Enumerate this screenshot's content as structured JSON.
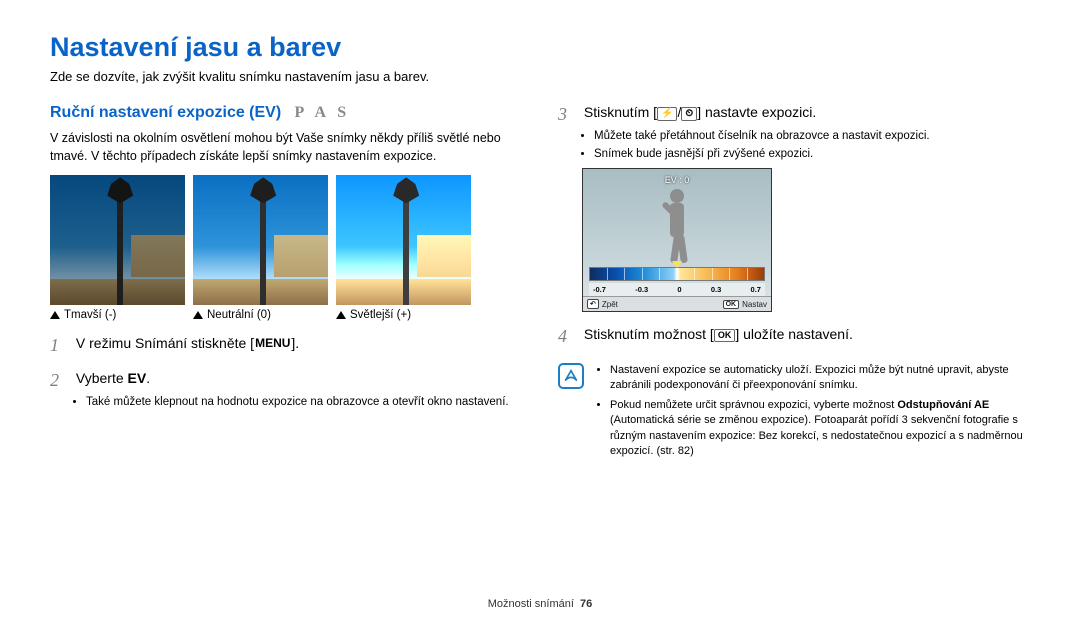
{
  "title": "Nastavení jasu a barev",
  "intro": "Zde se dozvíte, jak zvýšit kvalitu snímku nastavením jasu a barev.",
  "left": {
    "subhead": "Ruční nastavení expozice (EV)",
    "modes": "P A S",
    "para": "V závislosti na okolním osvětlení mohou být Vaše snímky někdy příliš světlé nebo tmavé. V těchto případech získáte lepší snímky nastavením expozice.",
    "captions": [
      "Tmavší (-)",
      "Neutrální (0)",
      "Světlejší (+)"
    ],
    "step1": {
      "pre": "V režimu Snímání stiskněte [",
      "key": "MENU",
      "post": "]."
    },
    "step2": {
      "pre": "Vyberte ",
      "bold": "EV",
      "post": "."
    },
    "step2bullet": "Také můžete klepnout na hodnotu expozice na obrazovce a otevřít okno nastavení."
  },
  "right": {
    "step3": {
      "pre": "Stisknutím [",
      "k1": "⚡",
      "sep": "/",
      "k2": "⏲",
      "post": "] nastavte expozici."
    },
    "step3bullets": [
      "Můžete také přetáhnout číselník na obrazovce a nastavit expozici.",
      "Snímek bude jasnější při zvýšené expozici."
    ],
    "screen": {
      "ev": "EV : 0",
      "vals": [
        "-0.7",
        "-0.3",
        "0",
        "0.3",
        "0.7"
      ],
      "back": "Zpět",
      "ok": "OK",
      "set": "Nastav"
    },
    "step4": {
      "pre": "Stisknutím možnost [",
      "key": "OK",
      "post": "] uložíte nastavení."
    },
    "note": {
      "b1": "Nastavení expozice se automaticky uloží. Expozici může být nutné upravit, abyste zabránili podexponování či přeexponování snímku.",
      "b2a": "Pokud nemůžete určit správnou expozici, vyberte možnost ",
      "b2bold": "Odstupňování AE",
      "b2b": " (Automatická série se změnou expozice). Fotoaparát pořídí 3 sekvenční fotografie s různým nastavením expozice: Bez korekcí, s nedostatečnou expozicí a s nadměrnou expozicí. (str. 82)"
    }
  },
  "footer": {
    "section": "Možnosti snímání",
    "page": "76"
  }
}
